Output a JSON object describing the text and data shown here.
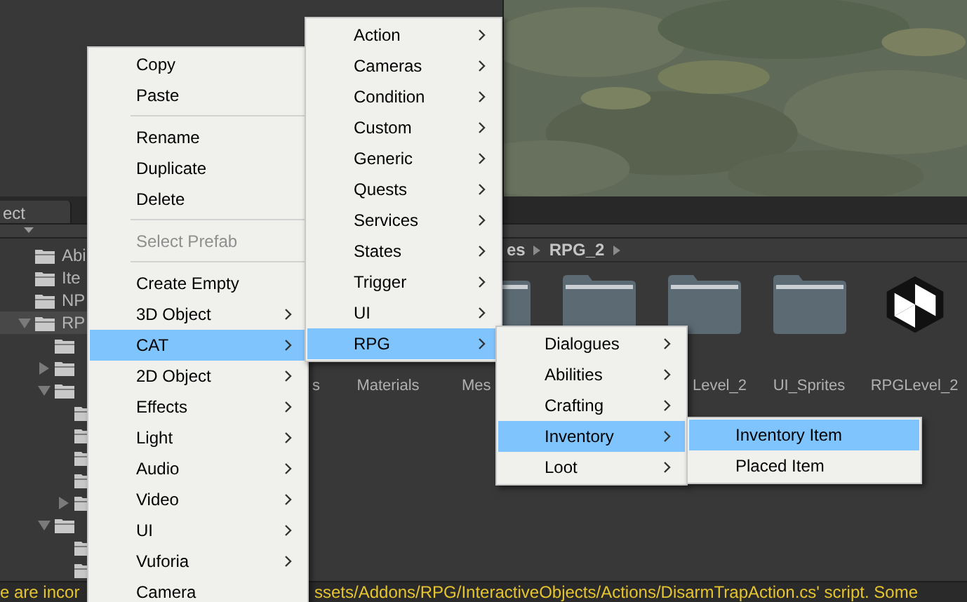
{
  "project_tab": {
    "label": "ect"
  },
  "tree": {
    "items": [
      {
        "label": "Abi",
        "selected": false
      },
      {
        "label": "Ite",
        "selected": false
      },
      {
        "label": "NP",
        "selected": false
      },
      {
        "label": "RP",
        "selected": true,
        "expanded": true,
        "children": [
          {
            "selected": false
          },
          {
            "selected": false,
            "expanded": false
          },
          {
            "selected": false,
            "expanded": true,
            "children": [
              {
                "selected": false
              },
              {
                "selected": false
              },
              {
                "selected": false
              },
              {
                "selected": false
              },
              {
                "selected": false,
                "expanded": false
              }
            ]
          },
          {
            "selected": false,
            "expanded": true,
            "children": [
              {
                "selected": false
              },
              {
                "selected": false
              }
            ]
          }
        ]
      }
    ]
  },
  "breadcrumb": [
    "es",
    "RPG_2"
  ],
  "assets": [
    {
      "kind": "label",
      "label": "s"
    },
    {
      "kind": "label",
      "label": "Materials"
    },
    {
      "kind": "folder",
      "label": "Mes"
    },
    {
      "kind": "folder"
    },
    {
      "kind": "folder",
      "label": "Level_2"
    },
    {
      "kind": "folder",
      "label": "UI_Sprites"
    },
    {
      "kind": "scene",
      "label": "RPGLevel_2"
    }
  ],
  "status_bar": [
    "e are incor",
    "ssets/Addons/RPG/InteractiveObjects/Actions/DisarmTrapAction.cs' script. Some"
  ],
  "menus": [
    {
      "items": [
        {
          "kind": "item",
          "label": "Copy",
          "selected": false,
          "disabled": false
        },
        {
          "kind": "item",
          "label": "Paste",
          "selected": false,
          "disabled": false
        },
        {
          "kind": "separator"
        },
        {
          "kind": "item",
          "label": "Rename",
          "selected": false,
          "disabled": false
        },
        {
          "kind": "item",
          "label": "Duplicate",
          "selected": false,
          "disabled": false
        },
        {
          "kind": "item",
          "label": "Delete",
          "selected": false,
          "disabled": false
        },
        {
          "kind": "separator"
        },
        {
          "kind": "item",
          "label": "Select Prefab",
          "selected": false,
          "disabled": true
        },
        {
          "kind": "separator"
        },
        {
          "kind": "item",
          "label": "Create Empty",
          "selected": false,
          "disabled": false
        },
        {
          "kind": "submenu",
          "label": "3D Object",
          "selected": false,
          "disabled": false
        },
        {
          "kind": "submenu",
          "label": "CAT",
          "selected": true,
          "disabled": false
        },
        {
          "kind": "submenu",
          "label": "2D Object",
          "selected": false,
          "disabled": false
        },
        {
          "kind": "submenu",
          "label": "Effects",
          "selected": false,
          "disabled": false
        },
        {
          "kind": "submenu",
          "label": "Light",
          "selected": false,
          "disabled": false
        },
        {
          "kind": "submenu",
          "label": "Audio",
          "selected": false,
          "disabled": false
        },
        {
          "kind": "submenu",
          "label": "Video",
          "selected": false,
          "disabled": false
        },
        {
          "kind": "submenu",
          "label": "UI",
          "selected": false,
          "disabled": false
        },
        {
          "kind": "submenu",
          "label": "Vuforia",
          "selected": false,
          "disabled": false
        },
        {
          "kind": "item",
          "label": "Camera",
          "selected": false,
          "disabled": false
        }
      ]
    },
    {
      "items": [
        {
          "kind": "submenu",
          "label": "Action",
          "selected": false
        },
        {
          "kind": "submenu",
          "label": "Cameras",
          "selected": false
        },
        {
          "kind": "submenu",
          "label": "Condition",
          "selected": false
        },
        {
          "kind": "submenu",
          "label": "Custom",
          "selected": false
        },
        {
          "kind": "submenu",
          "label": "Generic",
          "selected": false
        },
        {
          "kind": "submenu",
          "label": "Quests",
          "selected": false
        },
        {
          "kind": "submenu",
          "label": "Services",
          "selected": false
        },
        {
          "kind": "submenu",
          "label": "States",
          "selected": false
        },
        {
          "kind": "submenu",
          "label": "Trigger",
          "selected": false
        },
        {
          "kind": "submenu",
          "label": "UI",
          "selected": false
        },
        {
          "kind": "submenu",
          "label": "RPG",
          "selected": true
        }
      ]
    },
    {
      "items": [
        {
          "kind": "submenu",
          "label": "Dialogues",
          "selected": false
        },
        {
          "kind": "submenu",
          "label": "Abilities",
          "selected": false
        },
        {
          "kind": "submenu",
          "label": "Crafting",
          "selected": false
        },
        {
          "kind": "submenu",
          "label": "Inventory",
          "selected": true
        },
        {
          "kind": "submenu",
          "label": "Loot",
          "selected": false
        }
      ]
    },
    {
      "items": [
        {
          "kind": "item",
          "label": "Inventory Item",
          "selected": true
        },
        {
          "kind": "item",
          "label": "Placed Item",
          "selected": false
        }
      ]
    }
  ]
}
